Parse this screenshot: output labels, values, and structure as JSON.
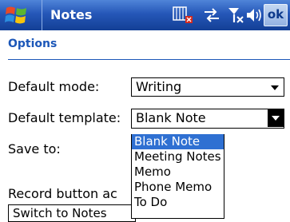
{
  "titlebar": {
    "app_title": "Notes",
    "ok_label": "ok"
  },
  "page": {
    "header": "Options"
  },
  "form": {
    "default_mode": {
      "label": "Default mode:",
      "value": "Writing"
    },
    "default_template": {
      "label": "Default template:",
      "value": "Blank Note",
      "options": [
        "Blank Note",
        "Meeting Notes",
        "Memo",
        "Phone Memo",
        "To Do"
      ],
      "selected_index": 0
    },
    "save_to": {
      "label": "Save to:"
    },
    "record_button": {
      "label": "Record button ac",
      "value": "Switch to Notes"
    }
  },
  "icons": {
    "start": "windows-flag-icon",
    "input_panel": "keyboard-input-icon",
    "connectivity": "connectivity-arrows-icon",
    "signal": "signal-off-icon",
    "volume": "volume-icon"
  },
  "colors": {
    "titlebar": "#2557b8",
    "header_text": "#1c57b8",
    "selection": "#2f70d2"
  }
}
